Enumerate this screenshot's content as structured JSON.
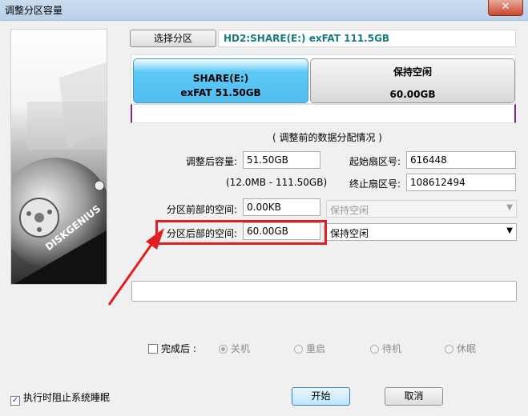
{
  "window": {
    "title": "调整分区容量",
    "close_glyph": "✕"
  },
  "top": {
    "select_button": "选择分区",
    "partition_info": "HD2:SHARE(E:) exFAT 111.5GB"
  },
  "disk_map": {
    "partition": {
      "name": "SHARE(E:)",
      "detail": "exFAT 51.50GB"
    },
    "free": {
      "label": "保持空闲",
      "size": "60.00GB"
    }
  },
  "caption": "( 调整前的数据分配情况 )",
  "form": {
    "adjusted_size_label": "调整后容量:",
    "adjusted_size_value": "51.50GB",
    "range_text": "(12.0MB - 111.50GB)",
    "start_sector_label": "起始扇区号:",
    "start_sector_value": "616448",
    "end_sector_label": "终止扇区号:",
    "end_sector_value": "108612494",
    "space_before_label": "分区前部的空间:",
    "space_before_value": "0.00KB",
    "space_before_option": "保持空闲",
    "space_after_label": "分区后部的空间:",
    "space_after_value": "60.00GB",
    "space_after_option": "保持空闲"
  },
  "completion": {
    "label": "完成后 :",
    "options": [
      "关机",
      "重启",
      "待机",
      "休眠"
    ]
  },
  "bottom": {
    "prevent_sleep_label": "执行时阻止系统睡眠",
    "start_button": "开始",
    "cancel_button": "取消"
  },
  "side_logo": "DISKGENIUS",
  "colors": {
    "accent_blue": "#2a8fd1",
    "partition_fill": "#5cc8f5",
    "highlight_red": "#e02020",
    "info_teal": "#1a7a7a"
  }
}
